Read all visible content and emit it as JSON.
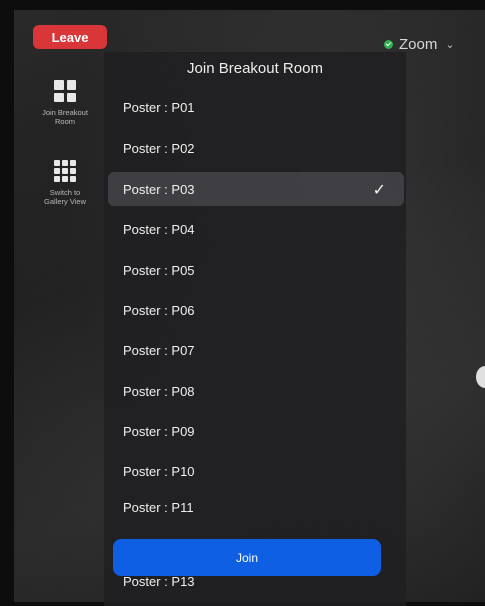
{
  "toolbar": {
    "leave_label": "Leave",
    "zoom_label": "Zoom",
    "zoom_chevron": "⌄"
  },
  "sidebar": {
    "items": [
      {
        "label": "Join Breakout Room",
        "icon": "grid-2x2-icon"
      },
      {
        "label": "Switch to Gallery View",
        "icon": "grid-3x3-icon"
      }
    ]
  },
  "dialog": {
    "title": "Join Breakout Room",
    "rooms": [
      {
        "label": "Poster : P01",
        "selected": false
      },
      {
        "label": "Poster : P02",
        "selected": false
      },
      {
        "label": "Poster : P03",
        "selected": true
      },
      {
        "label": "Poster : P04",
        "selected": false
      },
      {
        "label": "Poster : P05",
        "selected": false
      },
      {
        "label": "Poster : P06",
        "selected": false
      },
      {
        "label": "Poster : P07",
        "selected": false
      },
      {
        "label": "Poster : P08",
        "selected": false
      },
      {
        "label": "Poster : P09",
        "selected": false
      },
      {
        "label": "Poster : P10",
        "selected": false
      },
      {
        "label": "Poster : P11",
        "selected": false
      },
      {
        "label": "Poster : P13",
        "selected": false
      }
    ],
    "check_glyph": "✓",
    "join_label": "Join"
  },
  "colors": {
    "leave": "#d9363a",
    "join": "#0e5fe4",
    "secure": "#2bb24c"
  }
}
